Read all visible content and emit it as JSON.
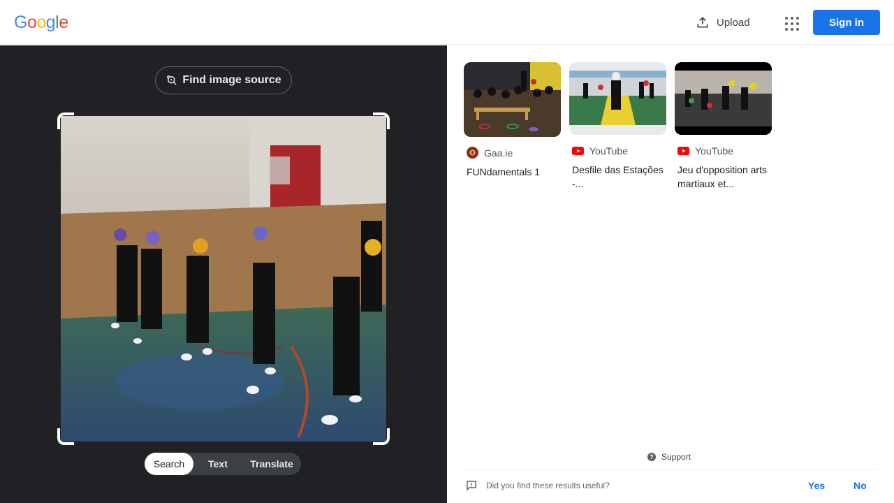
{
  "header": {
    "logo_letters": [
      "G",
      "o",
      "o",
      "g",
      "l",
      "e"
    ],
    "logo_colors": [
      "#4285f4",
      "#ea4335",
      "#fbbc05",
      "#4285f4",
      "#34a853",
      "#ea4335"
    ],
    "upload_label": "Upload",
    "signin_label": "Sign in",
    "accent_color": "#1a73e8"
  },
  "lens": {
    "find_source_label": "Find image source",
    "tabs": [
      {
        "label": "Search",
        "active": true
      },
      {
        "label": "Text",
        "active": false
      },
      {
        "label": "Translate",
        "active": false
      }
    ]
  },
  "results": [
    {
      "source": "Gaa.ie",
      "source_icon": "gaa-crest-icon",
      "title": "FUNdamentals 1"
    },
    {
      "source": "YouTube",
      "source_icon": "youtube-icon",
      "title": "Desfile das Estações -..."
    },
    {
      "source": "YouTube",
      "source_icon": "youtube-icon",
      "title": "Jeu d'opposition arts martiaux et..."
    }
  ],
  "footer": {
    "support_label": "Support",
    "feedback_question": "Did you find these results useful?",
    "yes_label": "Yes",
    "no_label": "No"
  }
}
